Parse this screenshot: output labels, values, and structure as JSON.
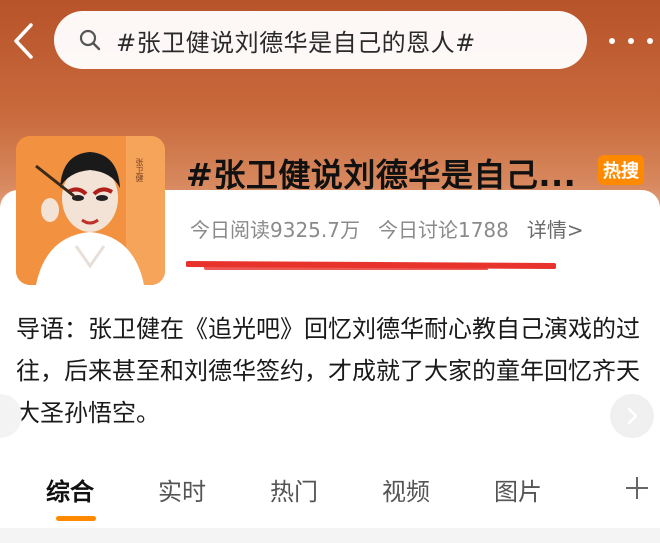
{
  "search": {
    "query": "#张卫健说刘德华是自己的恩人#"
  },
  "topic": {
    "title": "#张卫健说刘德华是自己...",
    "badge": "热搜",
    "reads": "今日阅读9325.7万",
    "discussions": "今日讨论1788",
    "detail_link": "详情>",
    "cover_caption": "张卫健"
  },
  "intro": {
    "text": "导语：张卫健在《追光吧》回忆刘德华耐心教自己演戏的过往，后来甚至和刘德华签约，才成就了大家的童年回忆齐天大圣孙悟空。"
  },
  "tabs": [
    {
      "label": "综合",
      "active": true
    },
    {
      "label": "实时",
      "active": false
    },
    {
      "label": "热门",
      "active": false
    },
    {
      "label": "视频",
      "active": false
    },
    {
      "label": "图片",
      "active": false
    }
  ],
  "colors": {
    "accent": "#ff8a00",
    "hero_top": "#b8532a",
    "redaction": "#e8322c"
  },
  "icons": {
    "back": "chevron-left-icon",
    "search": "search-icon",
    "more": "more-dots-icon",
    "add": "plus-icon",
    "next": "chevron-right-icon"
  }
}
